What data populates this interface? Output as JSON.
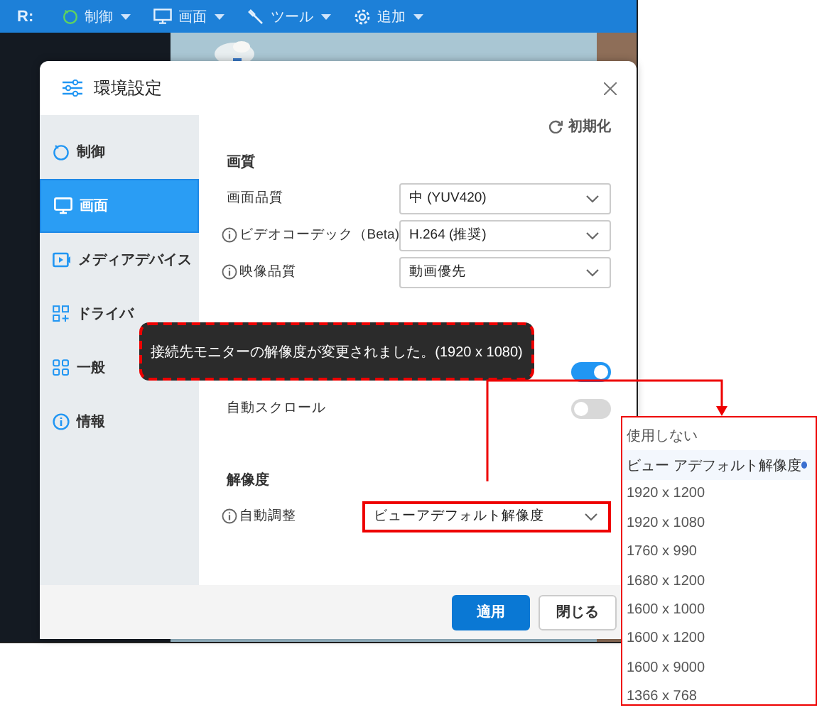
{
  "toolbar": {
    "logo": "R:",
    "menus": [
      {
        "label": "制御"
      },
      {
        "label": "画面"
      },
      {
        "label": "ツール"
      },
      {
        "label": "追加"
      }
    ]
  },
  "dialog": {
    "title": "環境設定",
    "sidebar": {
      "items": [
        {
          "label": "制御",
          "selected": false
        },
        {
          "label": "画面",
          "selected": true
        },
        {
          "label": "メディアデバイス",
          "selected": false
        },
        {
          "label": "ドライバ",
          "selected": false
        },
        {
          "label": "一般",
          "selected": false
        },
        {
          "label": "情報",
          "selected": false
        }
      ]
    },
    "reset": "初期化",
    "sections": [
      {
        "title": "画質",
        "rows": [
          {
            "kind": "select",
            "label": "画面品質",
            "info": false,
            "value": "中 (YUV420)",
            "annotated": false
          },
          {
            "kind": "select",
            "label": "ビデオコーデック（Beta)",
            "info": true,
            "value": "H.264 (推奨)",
            "annotated": false
          },
          {
            "kind": "select",
            "label": "映像品質",
            "info": true,
            "value": "動画優先",
            "annotated": false
          }
        ]
      },
      {
        "rows": [
          {
            "kind": "toggle",
            "on": true
          },
          {
            "kind": "toggle",
            "label": "自動スクロール",
            "on": false
          }
        ]
      },
      {
        "title": "解像度",
        "rows": [
          {
            "kind": "select",
            "label": "自動調整",
            "info": true,
            "value": "ビューアデフォルト解像度",
            "annotated": true
          }
        ]
      }
    ],
    "buttons": [
      {
        "label": "適用",
        "primary": true
      },
      {
        "label": "閉じる",
        "primary": false
      }
    ]
  },
  "toast": "接続先モニターの解像度が変更されました。(1920 x 1080)",
  "options": [
    {
      "label": "使用しない",
      "selected": false
    },
    {
      "label": "ビュー アデフォルト解像度",
      "selected": true
    },
    {
      "label": "1920 x 1200",
      "selected": false
    },
    {
      "label": "1920 x 1080",
      "selected": false
    },
    {
      "label": "1760 x 990",
      "selected": false
    },
    {
      "label": "1680 x 1200",
      "selected": false
    },
    {
      "label": "1600 x 1000",
      "selected": false
    },
    {
      "label": "1600 x 1200",
      "selected": false
    },
    {
      "label": "1600 x 9000",
      "selected": false
    },
    {
      "label": "1366 x 768",
      "selected": false
    }
  ]
}
